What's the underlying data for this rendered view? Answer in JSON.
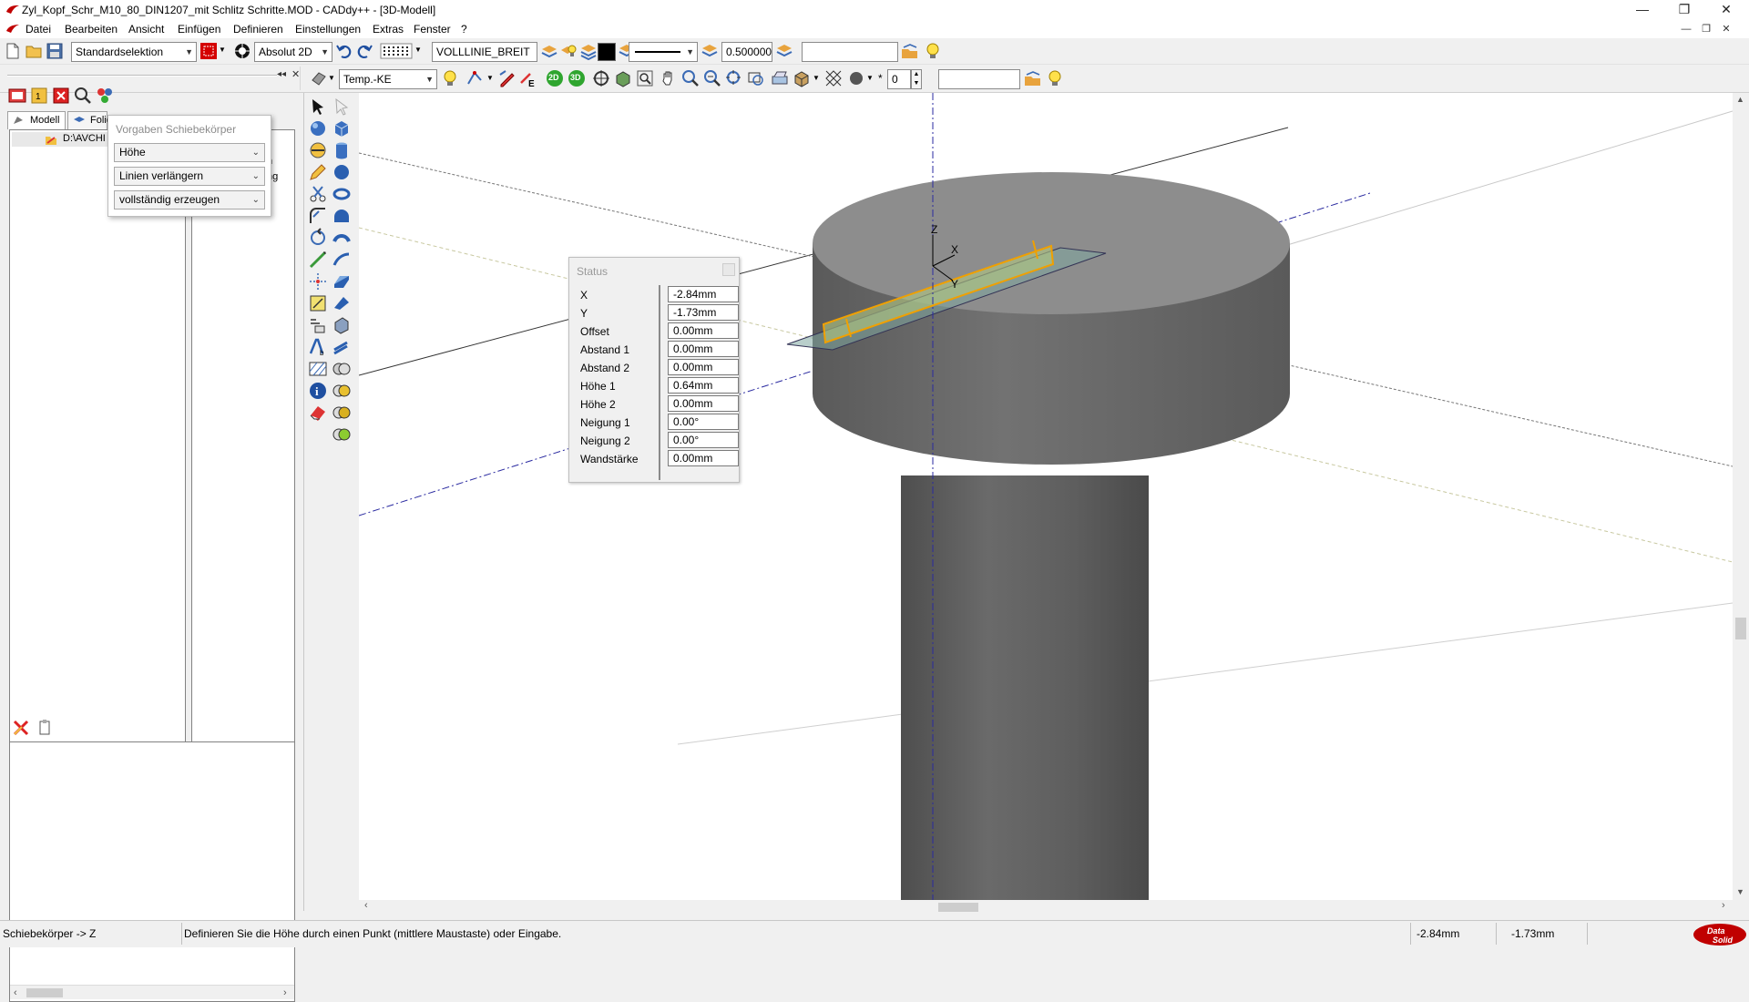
{
  "window": {
    "title": "Zyl_Kopf_Schr_M10_80_DIN1207_mit Schlitz Schritte.MOD   -   CADdy++ - [3D-Modell]",
    "min_glyph": "—",
    "max_glyph": "❐",
    "close_glyph": "✕"
  },
  "menu": {
    "items": [
      "Datei",
      "Bearbeiten",
      "Ansicht",
      "Einfügen",
      "Definieren",
      "Einstellungen",
      "Extras",
      "Fenster",
      "?"
    ]
  },
  "toolbar1": {
    "selection_mode": "Standardselektion",
    "coord_mode": "Absolut 2D",
    "line_type": "VOLLLINIE_BREIT",
    "line_width": "0.500000",
    "empty_field": ""
  },
  "toolbar2": {
    "temp_combo": "Temp.-KE",
    "btn_2d": "2D",
    "btn_3d": "3D",
    "step_value": "0",
    "empty_field": "",
    "star": "*"
  },
  "left_panel": {
    "tab_model": "Modell",
    "tab_folie": "Folie",
    "tree_root": "D:\\AVCHI",
    "partial_text_1": "n",
    "partial_text_2": "ng"
  },
  "vorgaben": {
    "title": "Vorgaben Schiebekörper",
    "option_1": "Höhe",
    "option_2": "Linien verlängern",
    "option_3": "vollständig erzeugen"
  },
  "status_dialog": {
    "title": "Status",
    "rows": [
      {
        "label": "X",
        "value": "-2.84mm"
      },
      {
        "label": "Y",
        "value": "-1.73mm"
      },
      {
        "label": "Offset",
        "value": "0.00mm"
      },
      {
        "label": "Abstand 1",
        "value": "0.00mm"
      },
      {
        "label": "Abstand 2",
        "value": "0.00mm"
      },
      {
        "label": "Höhe 1",
        "value": "0.64mm"
      },
      {
        "label": "Höhe 2",
        "value": "0.00mm"
      },
      {
        "label": "Neigung 1",
        "value": "0.00°"
      },
      {
        "label": "Neigung 2",
        "value": "0.00°"
      },
      {
        "label": "Wandstärke",
        "value": "0.00mm"
      }
    ]
  },
  "viewport": {
    "axis_z": "Z",
    "axis_x": "X",
    "axis_y": "Y"
  },
  "statusbar": {
    "mode": "Schiebekörper -> Z",
    "hint": "Definieren Sie die Höhe durch einen Punkt (mittlere Maustaste) oder Eingabe.",
    "coord_x": "-2.84mm",
    "coord_y": "-1.73mm",
    "logo_line1": "Data",
    "logo_line2": "Solid"
  },
  "colors": {
    "accent_red": "#c00000",
    "selection_orange": "#f0a000",
    "model_gray": "#6b6b6b",
    "axis_blue": "#1f2f9f"
  }
}
